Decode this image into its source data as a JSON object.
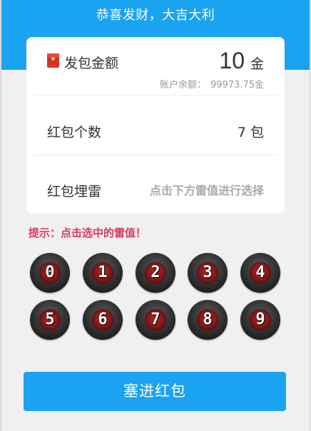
{
  "header": {
    "title": "恭喜发财，大吉大利"
  },
  "amount": {
    "label": "发包金额",
    "value": "10",
    "unit": "金"
  },
  "balance": {
    "label": "账户余额：",
    "value": "99973.75金"
  },
  "count": {
    "label": "红包个数",
    "value": "7",
    "unit": "包"
  },
  "mine": {
    "label": "红包埋雷",
    "hint": "点击下方雷值进行选择"
  },
  "tip": "提示：点击选中的雷值！",
  "mine_values": [
    "0",
    "1",
    "2",
    "3",
    "4",
    "5",
    "6",
    "7",
    "8",
    "9"
  ],
  "submit_label": "塞进红包",
  "colors": {
    "brand_blue": "#1aa3f0",
    "tip_pink": "#e1375f",
    "ball_red": "#b02a2a"
  },
  "icons": {
    "amount_icon": "red-packet-icon"
  }
}
